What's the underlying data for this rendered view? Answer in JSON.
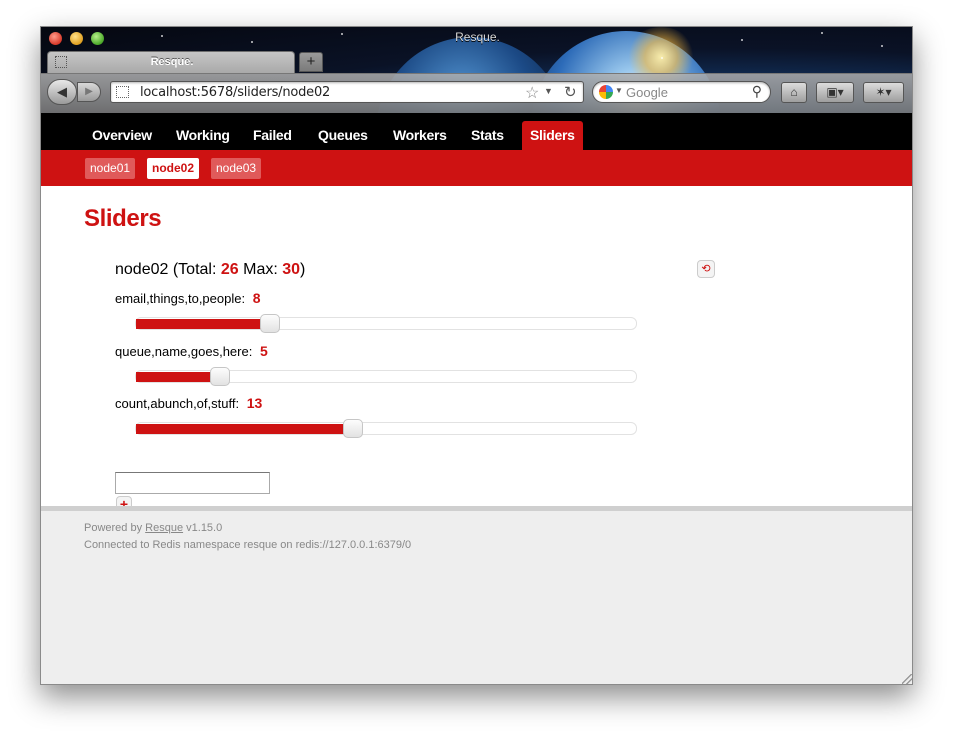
{
  "browser": {
    "window_title": "Resque.",
    "tab_label": "Resque.",
    "url": "localhost:5678/sliders/node02",
    "search_placeholder": "Google"
  },
  "nav": {
    "items": [
      "Overview",
      "Working",
      "Failed",
      "Queues",
      "Workers",
      "Stats",
      "Sliders"
    ],
    "active": "Sliders"
  },
  "subnav": {
    "items": [
      "node01",
      "node02",
      "node03"
    ],
    "active": "node02"
  },
  "page": {
    "title": "Sliders",
    "node": {
      "name": "node02",
      "total_label": "(Total:",
      "total": "26",
      "max_label": "Max:",
      "max": "30",
      "close_paren": ")"
    },
    "queues": [
      {
        "name": "email,things,to,people:",
        "value": "8",
        "fraction": 0.267
      },
      {
        "name": "queue,name,goes,here:",
        "value": "5",
        "fraction": 0.167
      },
      {
        "name": "count,abunch,of,stuff:",
        "value": "13",
        "fraction": 0.433
      }
    ],
    "add_button": "+",
    "refresh_icon": "refresh-icon"
  },
  "footer": {
    "powered_by": "Powered by",
    "resque_link": "Resque",
    "version": "v1.15.0",
    "connection": "Connected to Redis namespace resque on redis://127.0.0.1:6379/0"
  },
  "colors": {
    "accent": "#ce1212",
    "nav_bg": "#000000",
    "footer_bg": "#eeeeee"
  }
}
